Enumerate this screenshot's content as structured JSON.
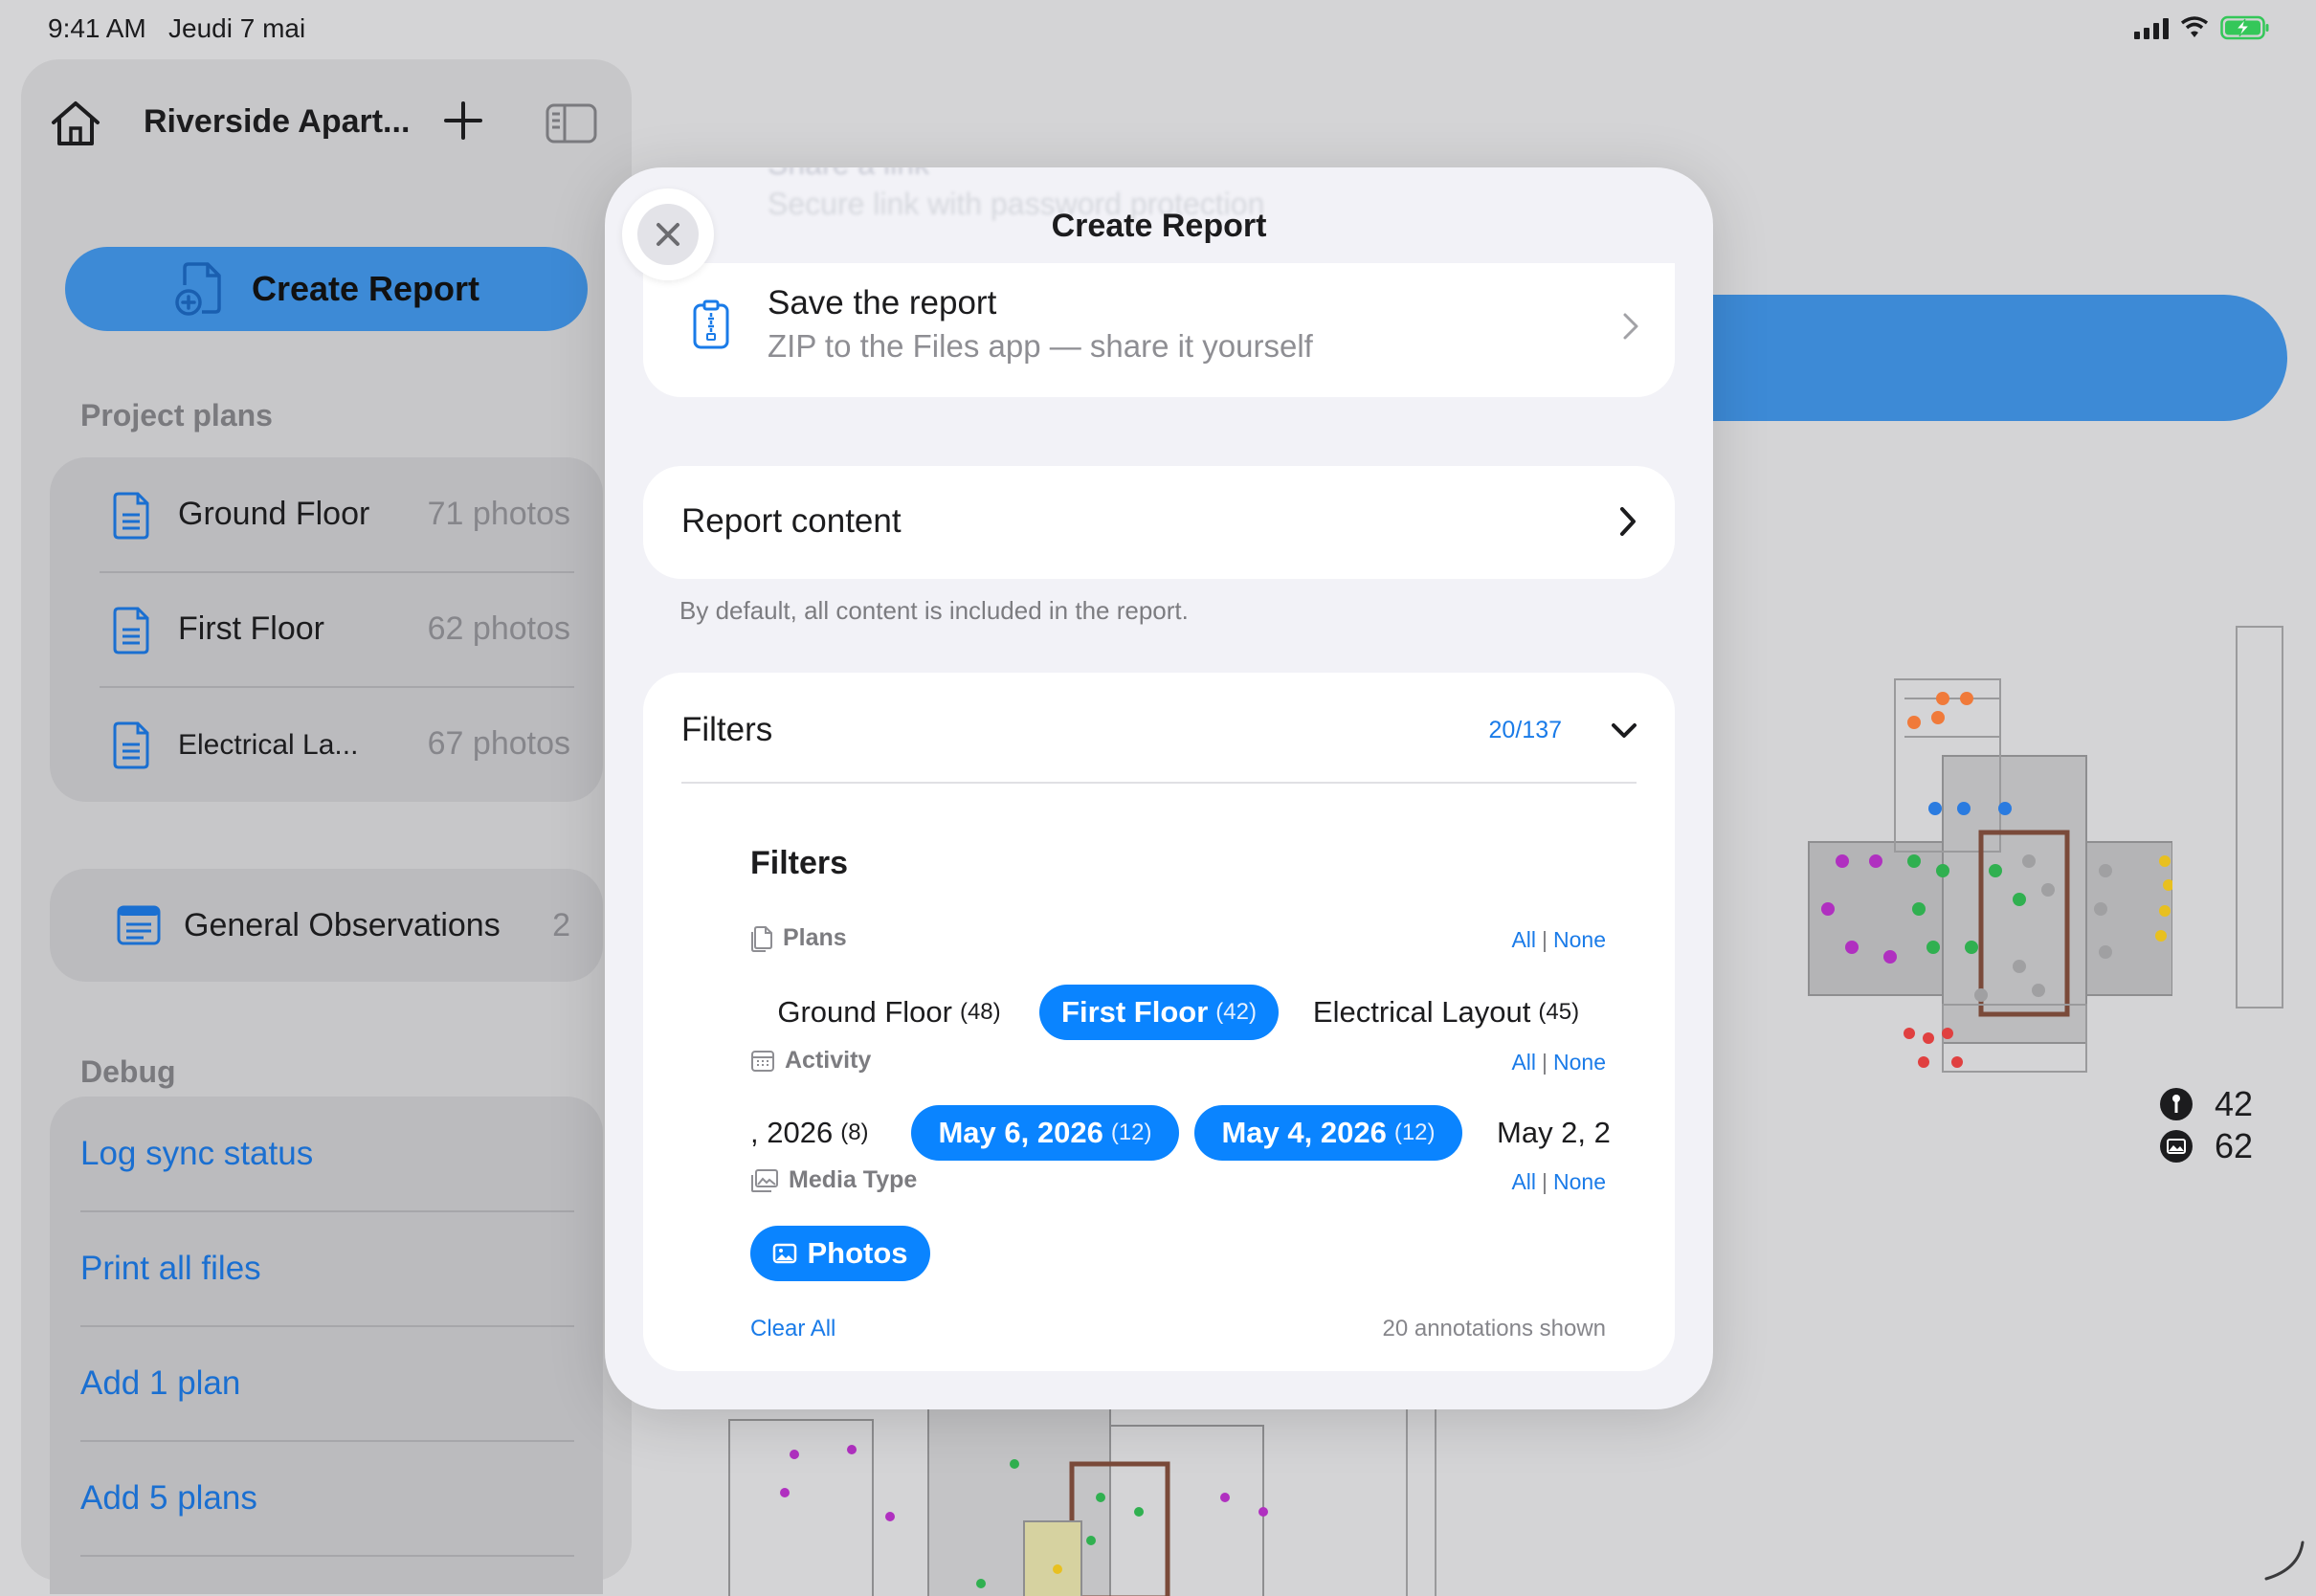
{
  "status_bar": {
    "time": "9:41 AM",
    "date": "Jeudi 7 mai"
  },
  "sidebar": {
    "project_title": "Riverside Apart...",
    "create_report_label": "Create Report",
    "project_plans_header": "Project plans",
    "plans": [
      {
        "name": "Ground Floor",
        "count": "71 photos"
      },
      {
        "name": "First Floor",
        "count": "62 photos"
      },
      {
        "name": "Electrical La...",
        "count": "67 photos"
      }
    ],
    "general_observations": {
      "label": "General Observations",
      "count": "2"
    },
    "debug_header": "Debug",
    "debug_items": [
      "Log sync status",
      "Print all files",
      "Add 1 plan",
      "Add 5 plans"
    ]
  },
  "background": {
    "ghost_title": "Share a link",
    "ghost_subtitle": "Secure link with password protection",
    "stats": [
      {
        "icon": "pin-icon",
        "value": "42"
      },
      {
        "icon": "photo-icon",
        "value": "62"
      }
    ]
  },
  "modal": {
    "title": "Create Report",
    "save": {
      "title": "Save the report",
      "subtitle": "ZIP to the Files app — share it yourself"
    },
    "report_content": {
      "label": "Report content",
      "note": "By default, all content is included in the report."
    },
    "filters": {
      "title": "Filters",
      "count": "20/137",
      "inner_title": "Filters",
      "all_label": "All",
      "none_label": "None",
      "plans": {
        "label": "Plans",
        "options": [
          {
            "name": "Ground Floor",
            "count": "(48)",
            "selected": false
          },
          {
            "name": "First Floor",
            "count": "(42)",
            "selected": true
          },
          {
            "name": "Electrical Layout",
            "count": "(45)",
            "selected": false
          }
        ]
      },
      "activity": {
        "label": "Activity",
        "options": [
          {
            "name": ", 2026",
            "count": "(8)",
            "selected": false
          },
          {
            "name": "May 6, 2026",
            "count": "(12)",
            "selected": true
          },
          {
            "name": "May 4, 2026",
            "count": "(12)",
            "selected": true
          },
          {
            "name": "May 2, 2",
            "count": "",
            "selected": false
          }
        ]
      },
      "media_type": {
        "label": "Media Type",
        "options": [
          {
            "name": "Photos",
            "selected": true
          }
        ]
      },
      "clear_all": "Clear All",
      "shown": "20 annotations shown"
    }
  },
  "colors": {
    "accent": "#0a84ff",
    "sidebar_button": "#3d8ad6",
    "link": "#1a6fd1"
  }
}
